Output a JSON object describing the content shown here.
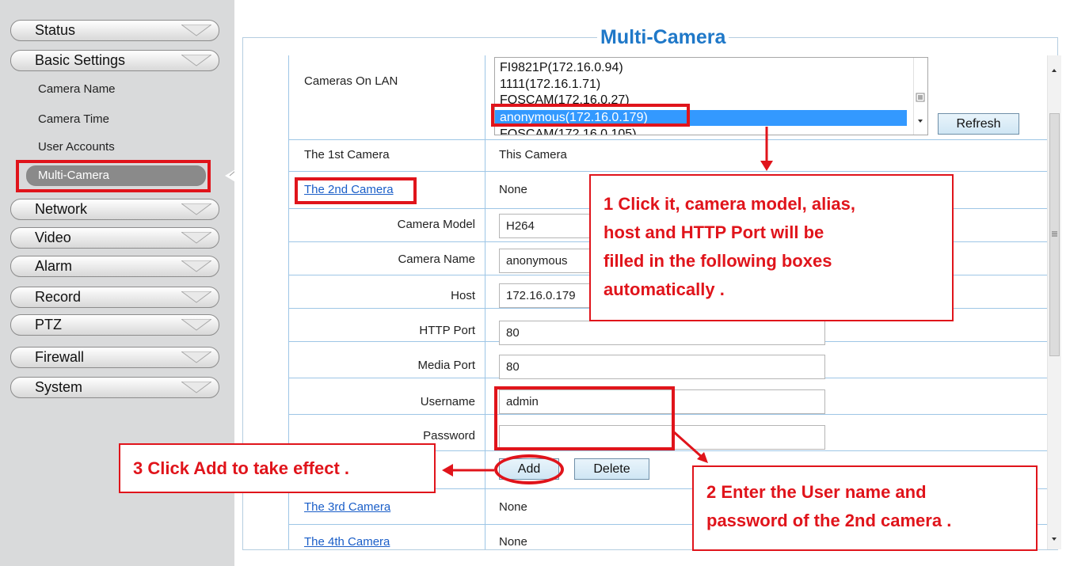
{
  "page_title": "Multi-Camera",
  "sidebar": {
    "items": [
      {
        "label": "Status"
      },
      {
        "label": "Basic Settings"
      },
      {
        "label": "Network"
      },
      {
        "label": "Video"
      },
      {
        "label": "Alarm"
      },
      {
        "label": "Record"
      },
      {
        "label": "PTZ"
      },
      {
        "label": "Firewall"
      },
      {
        "label": "System"
      }
    ],
    "sub_items": [
      {
        "label": "Camera Name"
      },
      {
        "label": "Camera Time"
      },
      {
        "label": "User Accounts"
      },
      {
        "label": "Multi-Camera"
      }
    ]
  },
  "cameras_on_lan": {
    "label": "Cameras On LAN",
    "items": [
      "FI9821P(172.16.0.94)",
      "1111(172.16.1.71)",
      "FOSCAM(172.16.0.27)",
      "anonymous(172.16.0.179)",
      "FOSCAM(172.16.0.105)"
    ],
    "selected": "anonymous(172.16.0.179)",
    "refresh_label": "Refresh"
  },
  "cameras": {
    "first": {
      "label": "The 1st Camera",
      "value": "This Camera"
    },
    "second": {
      "label": "The 2nd Camera",
      "value": "None"
    },
    "third": {
      "label": "The 3rd Camera",
      "value": "None"
    },
    "fourth": {
      "label": "The 4th Camera",
      "value": "None"
    }
  },
  "form": {
    "camera_model": {
      "label": "Camera Model",
      "value": "H264"
    },
    "camera_name": {
      "label": "Camera Name",
      "value": "anonymous"
    },
    "host": {
      "label": "Host",
      "value": "172.16.0.179"
    },
    "http_port": {
      "label": "HTTP Port",
      "value": "80"
    },
    "media_port": {
      "label": "Media Port",
      "value": "80"
    },
    "username": {
      "label": "Username",
      "value": "admin"
    },
    "password": {
      "label": "Password",
      "value": ""
    },
    "add_label": "Add",
    "delete_label": "Delete"
  },
  "annotations": {
    "step1": [
      "1 Click it, camera model, alias,",
      "host and HTTP Port will be",
      "filled in the following boxes",
      "automatically ."
    ],
    "step2": [
      "2 Enter the User name and",
      "password of the 2nd camera ."
    ],
    "step3": "3 Click Add to take effect ."
  },
  "colors": {
    "accent": "#1f78c8",
    "annotation_red": "#e0141b",
    "selection": "#3399ff"
  }
}
